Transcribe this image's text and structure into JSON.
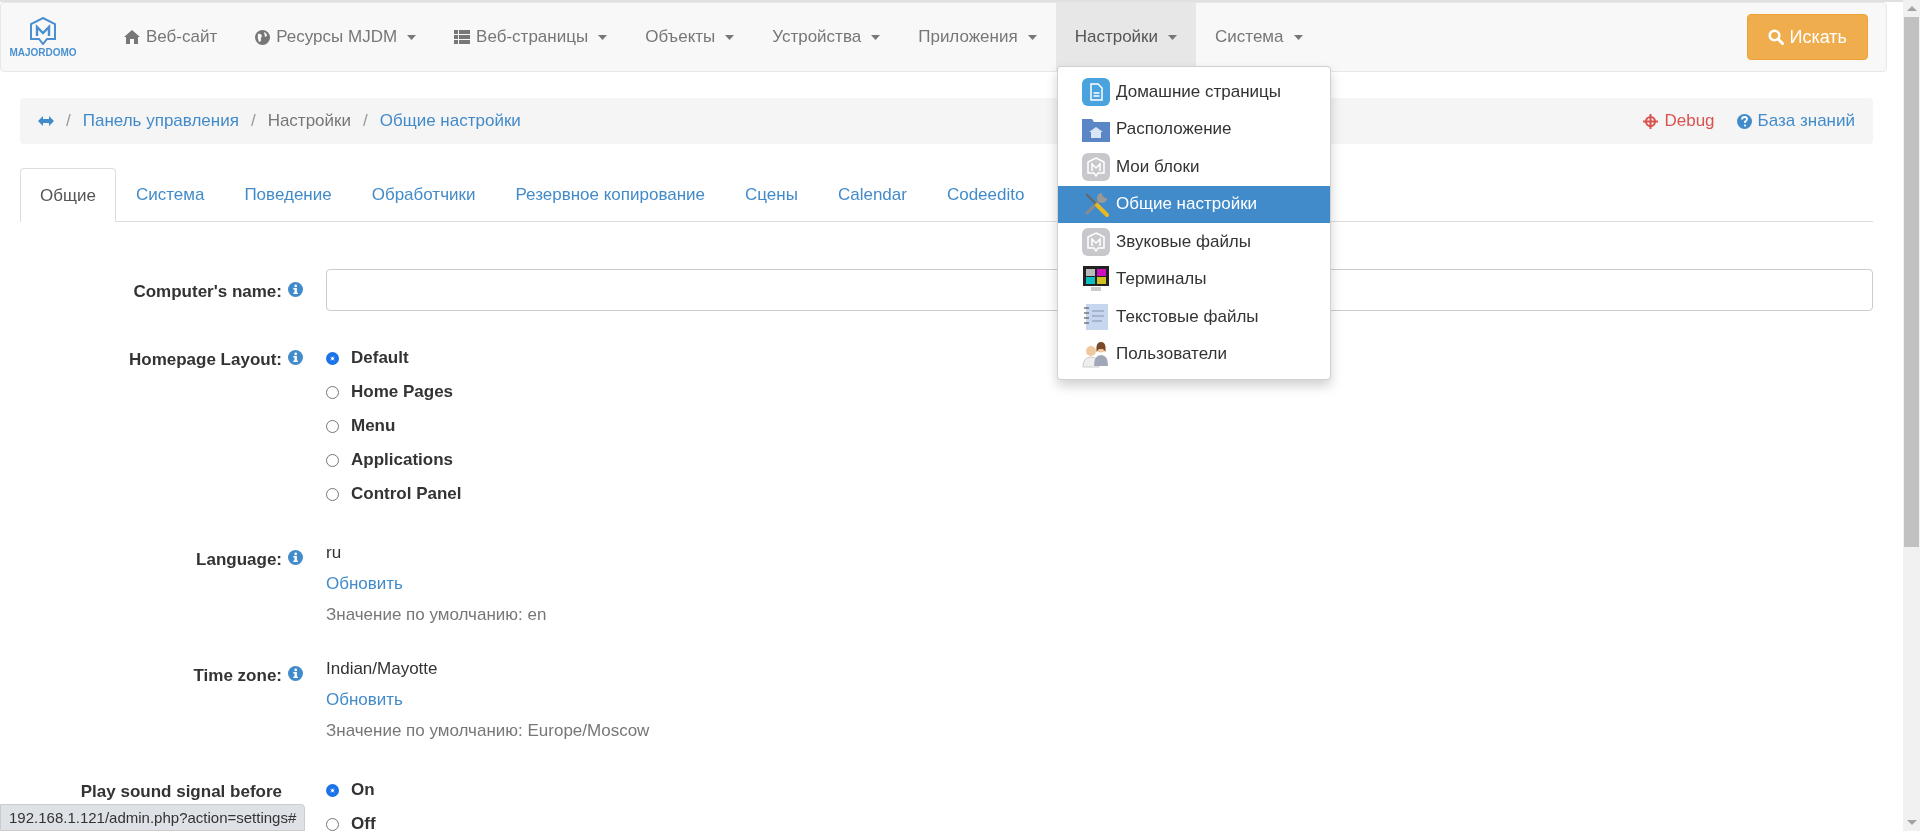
{
  "navbar": {
    "logo_text": "MAJORDOMO",
    "items": [
      {
        "label": "Веб-сайт",
        "kind": "home",
        "dropdown": false,
        "selected": false
      },
      {
        "label": "Ресурсы MJDM",
        "kind": "globe",
        "dropdown": true,
        "selected": false
      },
      {
        "label": "Веб-страницы",
        "kind": "list",
        "dropdown": true,
        "selected": false
      },
      {
        "label": "Объекты",
        "kind": "plain",
        "dropdown": true,
        "selected": false
      },
      {
        "label": "Устройства",
        "kind": "plain",
        "dropdown": true,
        "selected": false
      },
      {
        "label": "Приложения",
        "kind": "plain",
        "dropdown": true,
        "selected": false
      },
      {
        "label": "Настройки",
        "kind": "plain",
        "dropdown": true,
        "selected": true
      },
      {
        "label": "Система",
        "kind": "plain",
        "dropdown": true,
        "selected": false
      }
    ],
    "search_button": "Искать"
  },
  "dropdown_menu": [
    {
      "label": "Домашние страницы",
      "kind": "document",
      "selected": false
    },
    {
      "label": "Расположение",
      "kind": "folder",
      "selected": false
    },
    {
      "label": "Мои блоки",
      "kind": "logo",
      "selected": false
    },
    {
      "label": "Общие настройки",
      "kind": "tools",
      "selected": true
    },
    {
      "label": "Звуковые файлы",
      "kind": "logo",
      "selected": false
    },
    {
      "label": "Терминалы",
      "kind": "monitor",
      "selected": false
    },
    {
      "label": "Текстовые файлы",
      "kind": "notepad",
      "selected": false
    },
    {
      "label": "Пользователи",
      "kind": "users",
      "selected": false
    }
  ],
  "breadcrumb": {
    "separator": "/",
    "items": [
      {
        "label": "Панель управления",
        "link": true
      },
      {
        "label": "Настройки",
        "link": false
      },
      {
        "label": "Общие настройки",
        "link": true
      }
    ],
    "actions": [
      {
        "label": "Debug",
        "kind": "debug"
      },
      {
        "label": "База знаний",
        "kind": "help"
      }
    ]
  },
  "tabs": [
    {
      "label": "Общие",
      "selected": true
    },
    {
      "label": "Система",
      "selected": false
    },
    {
      "label": "Поведение",
      "selected": false
    },
    {
      "label": "Обработчики",
      "selected": false
    },
    {
      "label": "Резервное копирование",
      "selected": false
    },
    {
      "label": "Сцены",
      "selected": false
    },
    {
      "label": "Calendar",
      "selected": false
    },
    {
      "label": "Codeedito",
      "selected": false
    }
  ],
  "form": [
    {
      "label": "Computer's name:",
      "kind": "text"
    },
    {
      "label": "Homepage Layout:",
      "kind": "radio",
      "options": [
        {
          "label": "Default",
          "selected": true
        },
        {
          "label": "Home Pages",
          "selected": false
        },
        {
          "label": "Menu",
          "selected": false
        },
        {
          "label": "Applications",
          "selected": false
        },
        {
          "label": "Control Panel",
          "selected": false
        }
      ]
    },
    {
      "label": "Language:",
      "kind": "value",
      "value": "ru",
      "link": "Обновить",
      "hint": "Значение по умолчанию: en"
    },
    {
      "label": "Time zone:",
      "kind": "value",
      "value": "Indian/Mayotte",
      "link": "Обновить",
      "hint": "Значение по умолчанию: Europe/Moscow"
    },
    {
      "label": "Play sound signal before",
      "kind": "radio",
      "options": [
        {
          "label": "On",
          "selected": true
        },
        {
          "label": "Off",
          "selected": false
        }
      ]
    }
  ],
  "status_url": "192.168.1.121/admin.php?action=settings#"
}
